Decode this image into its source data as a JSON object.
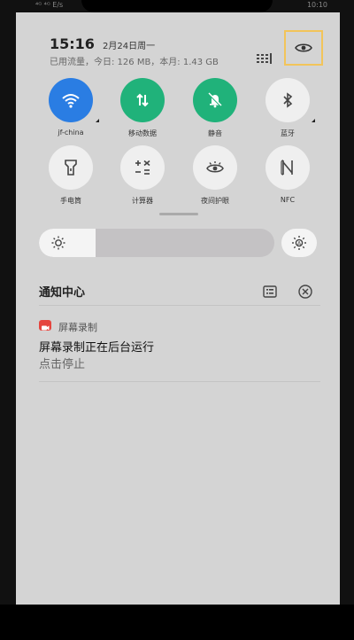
{
  "status": {
    "left_text": "⁴ᴳ ⁴ᴳ E/s",
    "right_text": "10:10"
  },
  "header": {
    "time": "15:16",
    "date": "2月24日周一",
    "traffic": "已用流量，今日: 126 MB，本月: 1.43 GB"
  },
  "toggles": [
    {
      "label": "jf-china",
      "icon": "wifi-icon",
      "state": "on"
    },
    {
      "label": "移动数据",
      "icon": "mobile-data-icon",
      "state": "on"
    },
    {
      "label": "静音",
      "icon": "mute-bell-icon",
      "state": "on"
    },
    {
      "label": "蓝牙",
      "icon": "bluetooth-icon",
      "state": "off"
    },
    {
      "label": "手电筒",
      "icon": "flashlight-icon",
      "state": "off"
    },
    {
      "label": "计算器",
      "icon": "calculator-icon",
      "state": "off"
    },
    {
      "label": "夜间护眼",
      "icon": "eye-care-icon",
      "state": "off"
    },
    {
      "label": "NFC",
      "icon": "nfc-icon",
      "state": "off"
    }
  ],
  "brightness": {
    "level": 0.24
  },
  "notification_center": {
    "title": "通知中心"
  },
  "notification": {
    "app_name": "屏幕录制",
    "title": "屏幕录制正在后台运行",
    "subtitle": "点击停止"
  },
  "colors": {
    "accent_blue": "#2a7de3",
    "accent_green": "#20b27a",
    "highlight": "#f2c45a",
    "record_red": "#e5453e"
  }
}
